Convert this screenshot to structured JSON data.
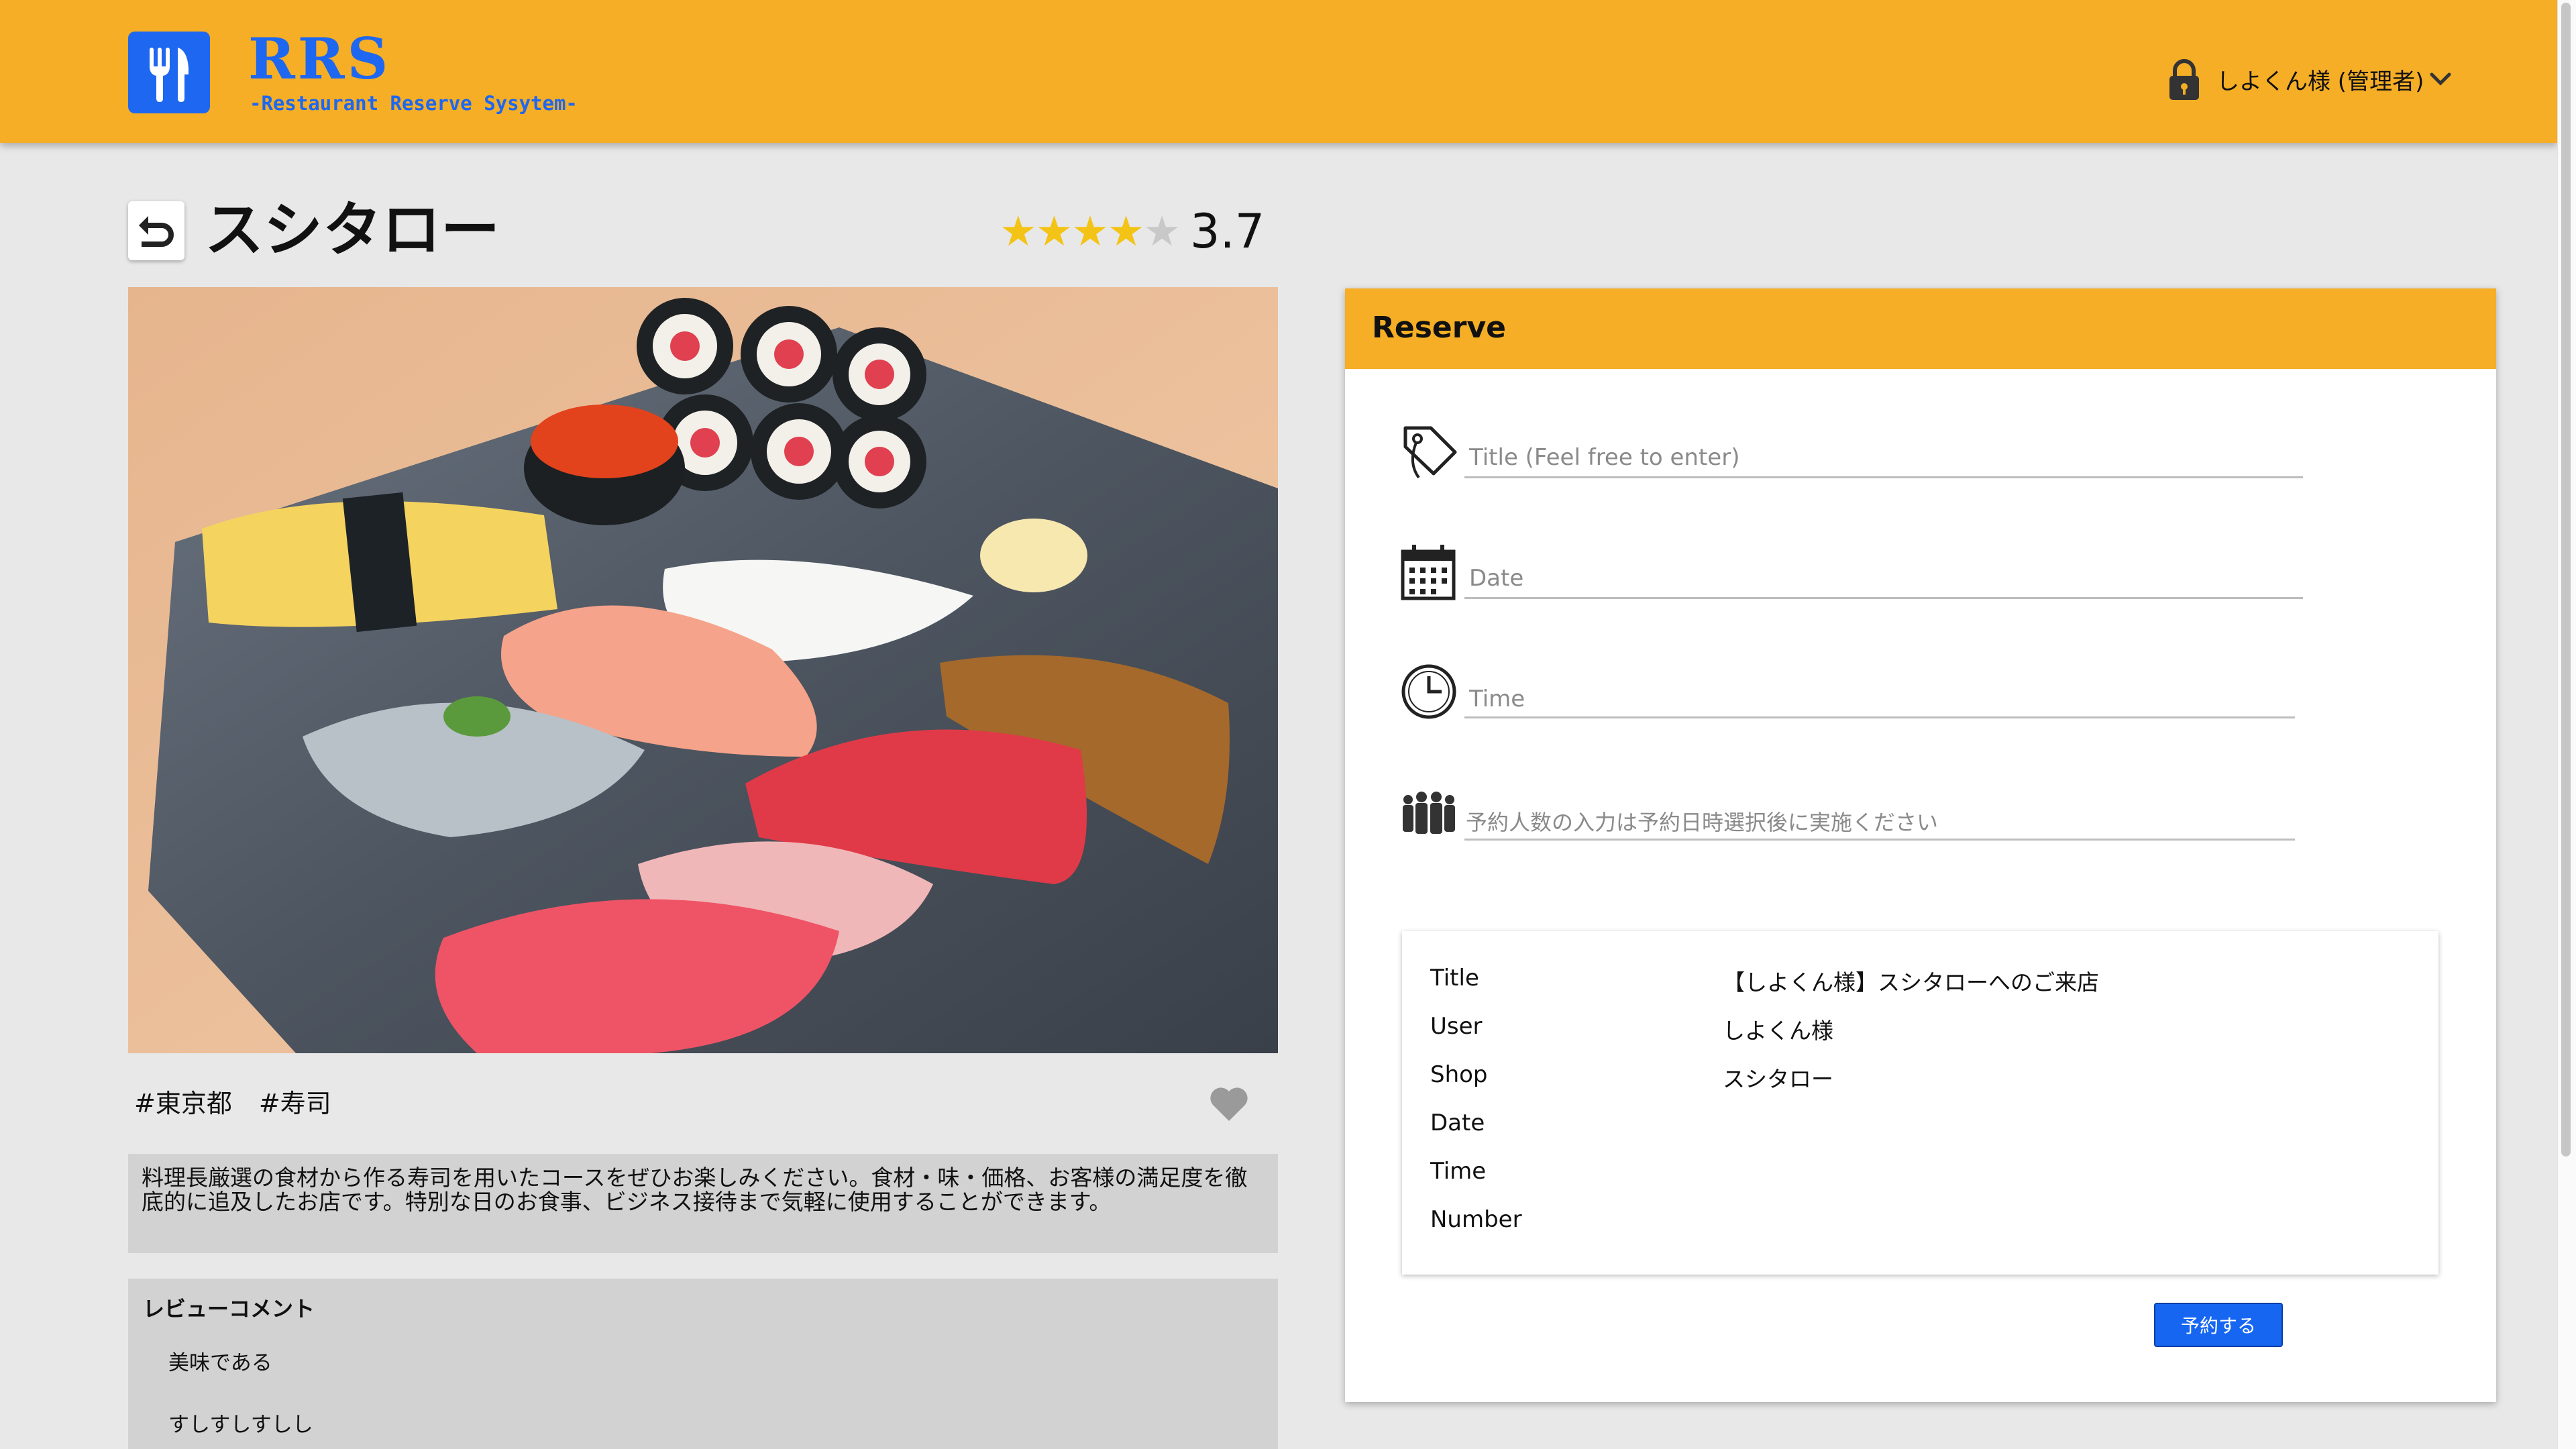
{
  "header": {
    "brand_name": "RRS",
    "brand_tagline": "-Restaurant Reserve Sysytem-",
    "user_name": "しよくん様 (管理者)"
  },
  "shop": {
    "name": "スシタロー",
    "rating": 3.7,
    "rating_text": "3.7",
    "rating_stars_filled": 4,
    "rating_stars_total": 5,
    "tags": [
      "#東京都",
      "#寿司"
    ],
    "description": "料理長厳選の食材から作る寿司を用いたコースをぜひお楽しみください。食材・味・価格、お客様の満足度を徹底的に追及したお店です。特別な日のお食事、ビジネス接待まで気軽に使用することができます。"
  },
  "reviews": {
    "heading": "レビューコメント",
    "items": [
      "美味である",
      "すしすしすしし"
    ]
  },
  "reserve": {
    "title": "Reserve",
    "fields": {
      "title_placeholder": "Title (Feel free to enter)",
      "date_placeholder": "Date",
      "time_placeholder": "Time",
      "people_placeholder": "予約人数の入力は予約日時選択後に実施ください"
    },
    "summary": {
      "labels": [
        "Title",
        "User",
        "Shop",
        "Date",
        "Time",
        "Number"
      ],
      "values": [
        "【しよくん様】スシタローへのご来店",
        "しよくん様",
        "スシタロー",
        "",
        "",
        ""
      ]
    },
    "submit_label": "予約する"
  },
  "colors": {
    "header_bg": "#f5ae25",
    "accent_blue": "#1e67f0",
    "button_blue": "#1666f2",
    "star_on": "#f3c316",
    "star_off": "#c8c8c8",
    "page_bg": "#e8e8e8"
  },
  "icons": [
    "fork-knife-icon",
    "lock-icon",
    "chevron-down-icon",
    "back-arrow-icon",
    "star-icon",
    "heart-icon",
    "tag-icon",
    "calendar-icon",
    "clock-icon",
    "people-icon"
  ]
}
